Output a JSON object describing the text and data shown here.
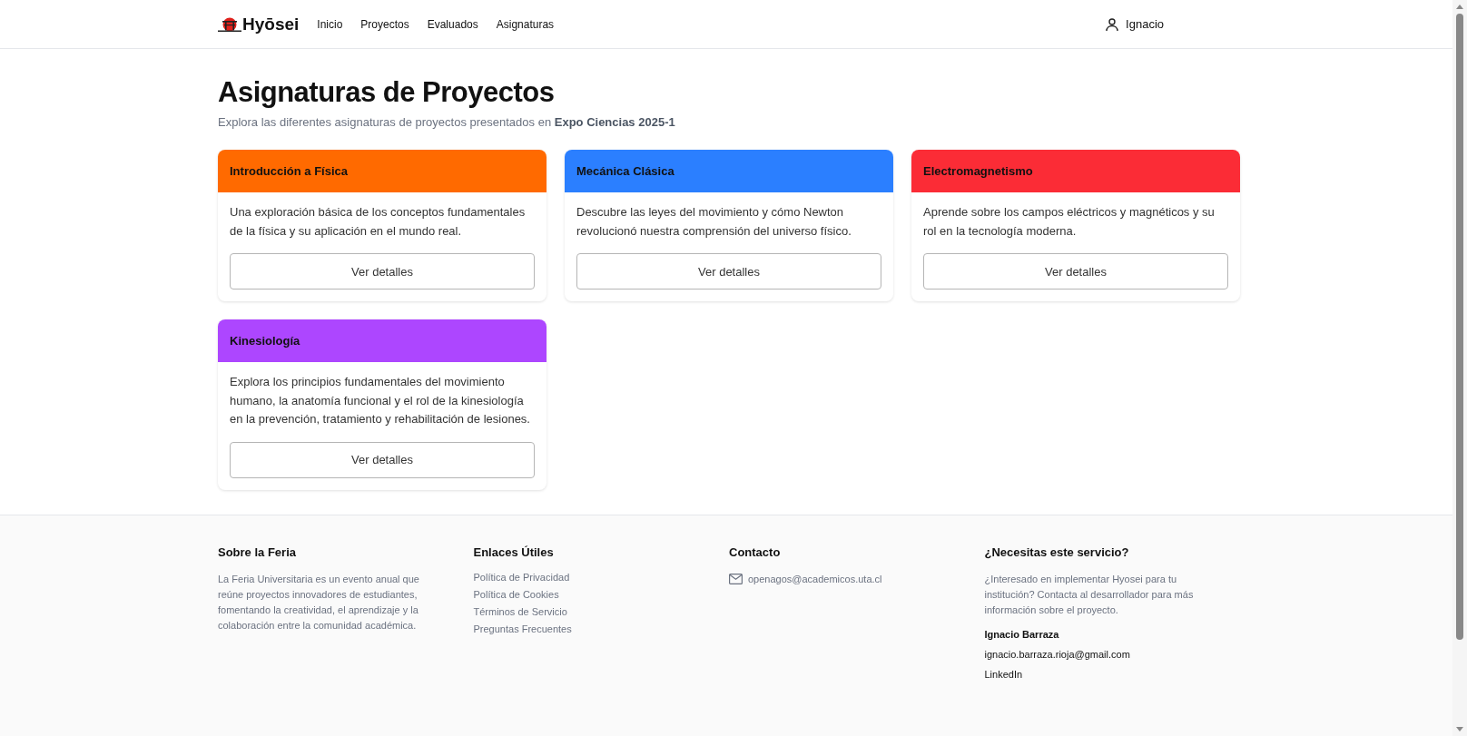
{
  "header": {
    "brand": "Hyōsei",
    "nav": [
      {
        "label": "Inicio"
      },
      {
        "label": "Proyectos"
      },
      {
        "label": "Evaluados"
      },
      {
        "label": "Asignaturas"
      }
    ],
    "user": "Ignacio"
  },
  "page": {
    "title": "Asignaturas de Proyectos",
    "subtitle": "Explora las diferentes asignaturas de proyectos presentados en **Expo Ciencias 2025-1**"
  },
  "subjects": [
    {
      "title": "Introducción a Física",
      "color": "#ff6a00",
      "description": "Una exploración básica de los conceptos fundamentales de la física y su aplicación en el mundo real.",
      "button": "Ver detalles"
    },
    {
      "title": "Mecánica Clásica",
      "color": "#2b7fff",
      "description": "Descubre las leyes del movimiento y cómo Newton revolucionó nuestra comprensión del universo físico.",
      "button": "Ver detalles"
    },
    {
      "title": "Electromagnetismo",
      "color": "#fb2c36",
      "description": "Aprende sobre los campos eléctricos y magnéticos y su rol en la tecnología moderna.",
      "button": "Ver detalles"
    },
    {
      "title": "Kinesiología",
      "color": "#ad46ff",
      "description": "Explora los principios fundamentales del movimiento humano, la anatomía funcional y el rol de la kinesiología en la prevención, tratamiento y rehabilitación de lesiones.",
      "button": "Ver detalles"
    }
  ],
  "footer": {
    "about": {
      "heading": "Sobre la Feria",
      "text": "La Feria Universitaria es un evento anual que reúne proyectos innovadores de estudiantes, fomentando la creatividad, el aprendizaje y la colaboración entre la comunidad académica."
    },
    "links": {
      "heading": "Enlaces Útiles",
      "items": [
        "Política de Privacidad",
        "Política de Cookies",
        "Términos de Servicio",
        "Preguntas Frecuentes"
      ]
    },
    "contact": {
      "heading": "Contacto",
      "email": "openagos@academicos.uta.cl"
    },
    "service": {
      "heading": "¿Necesitas este servicio?",
      "text": "¿Interesado en implementar Hyosei para tu institución? Contacta al desarrollador para más información sobre el proyecto.",
      "name": "Ignacio Barraza",
      "email": "ignacio.barraza.rioja@gmail.com",
      "link": "LinkedIn"
    }
  }
}
